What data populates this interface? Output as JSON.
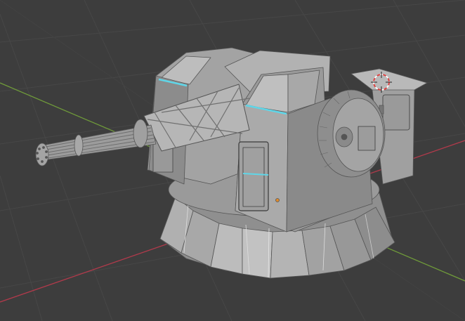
{
  "viewport": {
    "background": "#3d3d3d",
    "grid_color": "#474747",
    "x_axis_color": "#b13a4b",
    "y_axis_color": "#6f9a3a",
    "selection_edge_color": "#5fd6e8",
    "origin_marker_color": "#e23a3a",
    "model_light": "#a6a6a6",
    "model_mid": "#8f8f8f",
    "model_dark": "#6a6a6a",
    "light_color": "#e08a2a"
  },
  "objects": {
    "model": "turret-mesh",
    "cursor": "3d-cursor-icon"
  }
}
